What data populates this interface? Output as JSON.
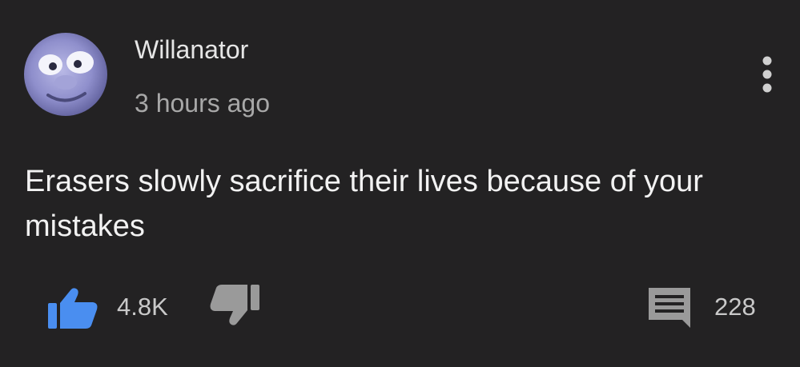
{
  "comment": {
    "author": "Willanator",
    "timestamp": "3 hours ago",
    "text": "Erasers slowly sacrifice their lives because of your mistakes",
    "like_count": "4.8K",
    "reply_count": "228"
  },
  "icons": {
    "avatar": "avatar-face",
    "menu": "more-vertical-icon",
    "like": "thumbs-up-icon",
    "dislike": "thumbs-down-icon",
    "reply": "comment-icon"
  },
  "colors": {
    "background": "#232223",
    "like_active": "#4a8ef0",
    "icon_grey": "#9a9a9a"
  }
}
